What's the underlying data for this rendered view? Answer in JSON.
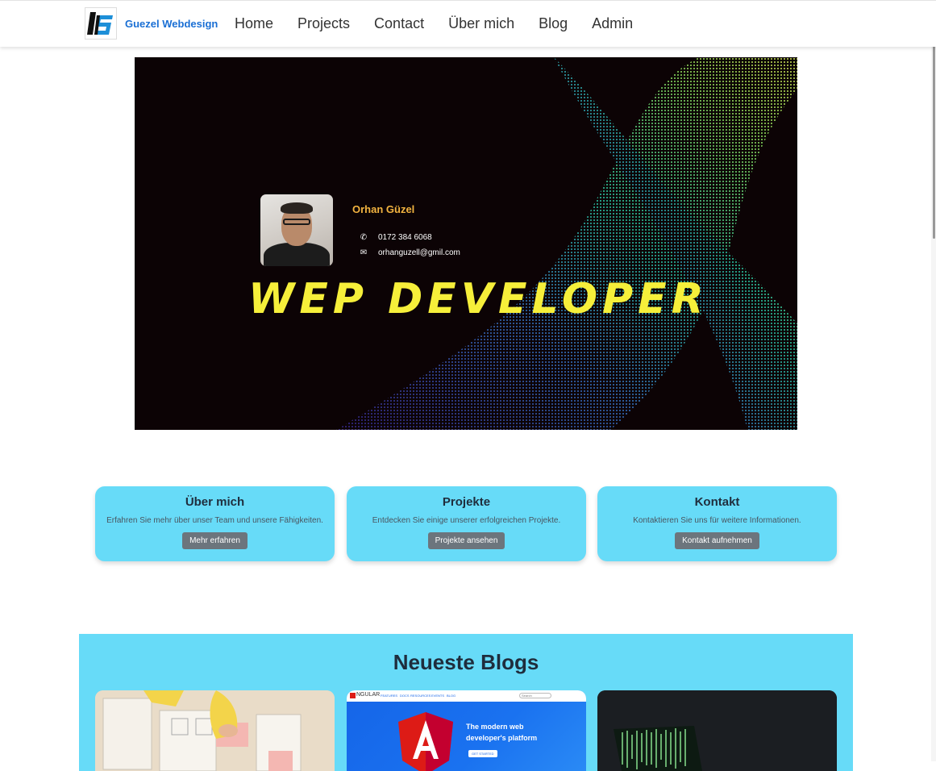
{
  "brand": {
    "name": "Guezel Webdesign",
    "logo": "GS-logo"
  },
  "nav": {
    "items": [
      "Home",
      "Projects",
      "Contact",
      "Über mich",
      "Blog",
      "Admin"
    ]
  },
  "hero": {
    "name": "Orhan Güzel",
    "phone": "0172 384 6068",
    "email": "orhanguzell@gmil.com",
    "headline": "WEP DEVELOPER",
    "phone_icon": "phone-icon",
    "email_icon": "mail-icon"
  },
  "cards": [
    {
      "title": "Über mich",
      "text": "Erfahren Sie mehr über unser Team und unsere Fähigkeiten.",
      "button": "Mehr erfahren"
    },
    {
      "title": "Projekte",
      "text": "Entdecken Sie einige unserer erfolgreichen Projekte.",
      "button": "Projekte ansehen"
    },
    {
      "title": "Kontakt",
      "text": "Kontaktieren Sie uns für weitere Informationen.",
      "button": "Kontakt aufnehmen"
    }
  ],
  "blogs": {
    "title": "Neueste Blogs",
    "angular_nav": [
      "NGULAR",
      "FEATURES",
      "DOCS",
      "RESOURCES",
      "EVENTS",
      "BLOG"
    ],
    "angular_search": "Search",
    "angular_tagline_1": "The modern web",
    "angular_tagline_2": "developer's platform",
    "angular_button": "GET STARTED"
  },
  "colors": {
    "accent": "#67dbf8",
    "brand": "#1a6fd4",
    "headline": "#f6ef3a",
    "name": "#f2b340"
  }
}
